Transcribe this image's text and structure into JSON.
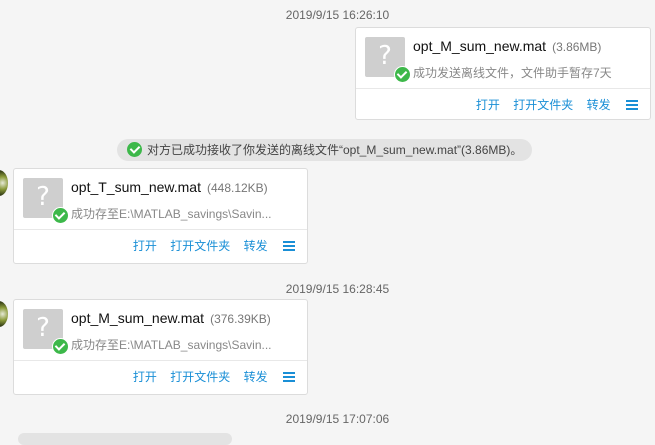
{
  "timestamps": [
    "2019/9/15 16:26:10",
    "2019/9/15 16:28:45",
    "2019/9/15 17:07:06"
  ],
  "messages": [
    {
      "file_name": "opt_M_sum_new.mat",
      "file_size": "(3.86MB)",
      "status": "成功发送离线文件，文件助手暂存7天",
      "actions": [
        "打开",
        "打开文件夹",
        "转发"
      ]
    },
    {
      "file_name": "opt_T_sum_new.mat",
      "file_size": "(448.12KB)",
      "status": "成功存至E:\\MATLAB_savings\\Savin...",
      "actions": [
        "打开",
        "打开文件夹",
        "转发"
      ]
    },
    {
      "file_name": "opt_M_sum_new.mat",
      "file_size": "(376.39KB)",
      "status": "成功存至E:\\MATLAB_savings\\Savin...",
      "actions": [
        "打开",
        "打开文件夹",
        "转发"
      ]
    }
  ],
  "notice": "对方已成功接收了你发送的离线文件“opt_M_sum_new.mat”(3.86MB)。",
  "icons": {
    "file": "question-file-icon",
    "status": "check-circle-icon",
    "menu": "hamburger-menu-icon"
  },
  "colors": {
    "link": "#1a8fd6",
    "success": "#3db84a",
    "thumb": "#cfcfcf"
  }
}
